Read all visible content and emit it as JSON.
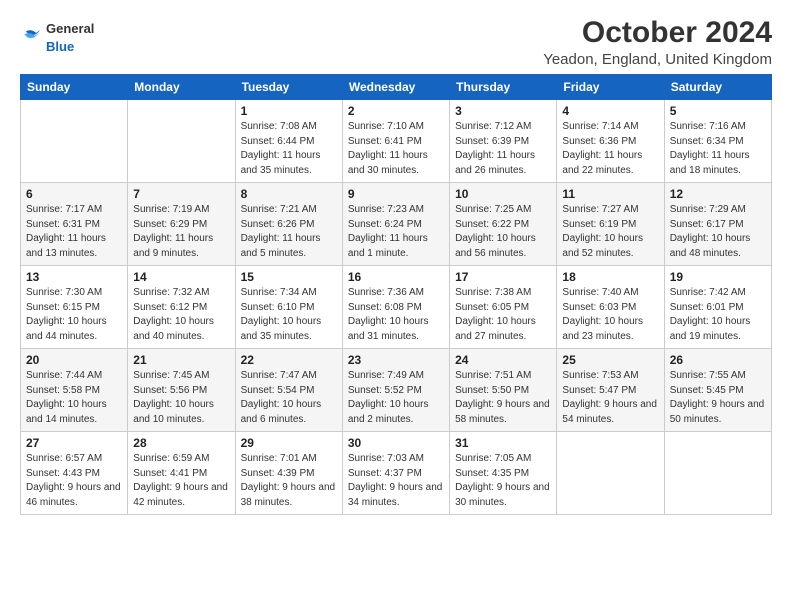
{
  "header": {
    "logo": {
      "general": "General",
      "blue": "Blue"
    },
    "title": "October 2024",
    "location": "Yeadon, England, United Kingdom"
  },
  "weekdays": [
    "Sunday",
    "Monday",
    "Tuesday",
    "Wednesday",
    "Thursday",
    "Friday",
    "Saturday"
  ],
  "weeks": [
    [
      {
        "day": "",
        "info": ""
      },
      {
        "day": "",
        "info": ""
      },
      {
        "day": "1",
        "info": "Sunrise: 7:08 AM\nSunset: 6:44 PM\nDaylight: 11 hours and 35 minutes."
      },
      {
        "day": "2",
        "info": "Sunrise: 7:10 AM\nSunset: 6:41 PM\nDaylight: 11 hours and 30 minutes."
      },
      {
        "day": "3",
        "info": "Sunrise: 7:12 AM\nSunset: 6:39 PM\nDaylight: 11 hours and 26 minutes."
      },
      {
        "day": "4",
        "info": "Sunrise: 7:14 AM\nSunset: 6:36 PM\nDaylight: 11 hours and 22 minutes."
      },
      {
        "day": "5",
        "info": "Sunrise: 7:16 AM\nSunset: 6:34 PM\nDaylight: 11 hours and 18 minutes."
      }
    ],
    [
      {
        "day": "6",
        "info": "Sunrise: 7:17 AM\nSunset: 6:31 PM\nDaylight: 11 hours and 13 minutes."
      },
      {
        "day": "7",
        "info": "Sunrise: 7:19 AM\nSunset: 6:29 PM\nDaylight: 11 hours and 9 minutes."
      },
      {
        "day": "8",
        "info": "Sunrise: 7:21 AM\nSunset: 6:26 PM\nDaylight: 11 hours and 5 minutes."
      },
      {
        "day": "9",
        "info": "Sunrise: 7:23 AM\nSunset: 6:24 PM\nDaylight: 11 hours and 1 minute."
      },
      {
        "day": "10",
        "info": "Sunrise: 7:25 AM\nSunset: 6:22 PM\nDaylight: 10 hours and 56 minutes."
      },
      {
        "day": "11",
        "info": "Sunrise: 7:27 AM\nSunset: 6:19 PM\nDaylight: 10 hours and 52 minutes."
      },
      {
        "day": "12",
        "info": "Sunrise: 7:29 AM\nSunset: 6:17 PM\nDaylight: 10 hours and 48 minutes."
      }
    ],
    [
      {
        "day": "13",
        "info": "Sunrise: 7:30 AM\nSunset: 6:15 PM\nDaylight: 10 hours and 44 minutes."
      },
      {
        "day": "14",
        "info": "Sunrise: 7:32 AM\nSunset: 6:12 PM\nDaylight: 10 hours and 40 minutes."
      },
      {
        "day": "15",
        "info": "Sunrise: 7:34 AM\nSunset: 6:10 PM\nDaylight: 10 hours and 35 minutes."
      },
      {
        "day": "16",
        "info": "Sunrise: 7:36 AM\nSunset: 6:08 PM\nDaylight: 10 hours and 31 minutes."
      },
      {
        "day": "17",
        "info": "Sunrise: 7:38 AM\nSunset: 6:05 PM\nDaylight: 10 hours and 27 minutes."
      },
      {
        "day": "18",
        "info": "Sunrise: 7:40 AM\nSunset: 6:03 PM\nDaylight: 10 hours and 23 minutes."
      },
      {
        "day": "19",
        "info": "Sunrise: 7:42 AM\nSunset: 6:01 PM\nDaylight: 10 hours and 19 minutes."
      }
    ],
    [
      {
        "day": "20",
        "info": "Sunrise: 7:44 AM\nSunset: 5:58 PM\nDaylight: 10 hours and 14 minutes."
      },
      {
        "day": "21",
        "info": "Sunrise: 7:45 AM\nSunset: 5:56 PM\nDaylight: 10 hours and 10 minutes."
      },
      {
        "day": "22",
        "info": "Sunrise: 7:47 AM\nSunset: 5:54 PM\nDaylight: 10 hours and 6 minutes."
      },
      {
        "day": "23",
        "info": "Sunrise: 7:49 AM\nSunset: 5:52 PM\nDaylight: 10 hours and 2 minutes."
      },
      {
        "day": "24",
        "info": "Sunrise: 7:51 AM\nSunset: 5:50 PM\nDaylight: 9 hours and 58 minutes."
      },
      {
        "day": "25",
        "info": "Sunrise: 7:53 AM\nSunset: 5:47 PM\nDaylight: 9 hours and 54 minutes."
      },
      {
        "day": "26",
        "info": "Sunrise: 7:55 AM\nSunset: 5:45 PM\nDaylight: 9 hours and 50 minutes."
      }
    ],
    [
      {
        "day": "27",
        "info": "Sunrise: 6:57 AM\nSunset: 4:43 PM\nDaylight: 9 hours and 46 minutes."
      },
      {
        "day": "28",
        "info": "Sunrise: 6:59 AM\nSunset: 4:41 PM\nDaylight: 9 hours and 42 minutes."
      },
      {
        "day": "29",
        "info": "Sunrise: 7:01 AM\nSunset: 4:39 PM\nDaylight: 9 hours and 38 minutes."
      },
      {
        "day": "30",
        "info": "Sunrise: 7:03 AM\nSunset: 4:37 PM\nDaylight: 9 hours and 34 minutes."
      },
      {
        "day": "31",
        "info": "Sunrise: 7:05 AM\nSunset: 4:35 PM\nDaylight: 9 hours and 30 minutes."
      },
      {
        "day": "",
        "info": ""
      },
      {
        "day": "",
        "info": ""
      }
    ]
  ]
}
